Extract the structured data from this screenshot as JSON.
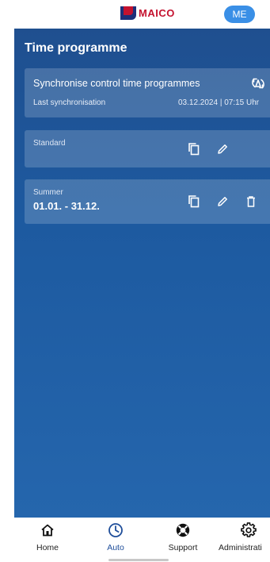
{
  "header": {
    "logo_text": "MAICO",
    "user_badge": "ME"
  },
  "main": {
    "title": "Time programme"
  },
  "sync_card": {
    "title": "Synchronise control time programmes",
    "last_sync_label": "Last synchronisation",
    "last_sync_value": "03.12.2024 | 07:15 Uhr"
  },
  "programmes": [
    {
      "name": "Standard",
      "range": ""
    },
    {
      "name": "Summer",
      "range": "01.01. - 31.12."
    }
  ],
  "nav": {
    "items": [
      {
        "label": "Home",
        "icon": "home-icon",
        "active": false
      },
      {
        "label": "Auto",
        "icon": "clock-icon",
        "active": true
      },
      {
        "label": "Support",
        "icon": "lifebuoy-icon",
        "active": false
      },
      {
        "label": "Administrati",
        "icon": "gear-icon",
        "active": false
      }
    ]
  },
  "colors": {
    "brand_red": "#c4122f",
    "brand_blue": "#1d2f7a",
    "accent": "#3a8fe6",
    "active_nav": "#1f4e9a",
    "panel_top": "#1f4f8f",
    "panel_bottom": "#2566ad"
  }
}
